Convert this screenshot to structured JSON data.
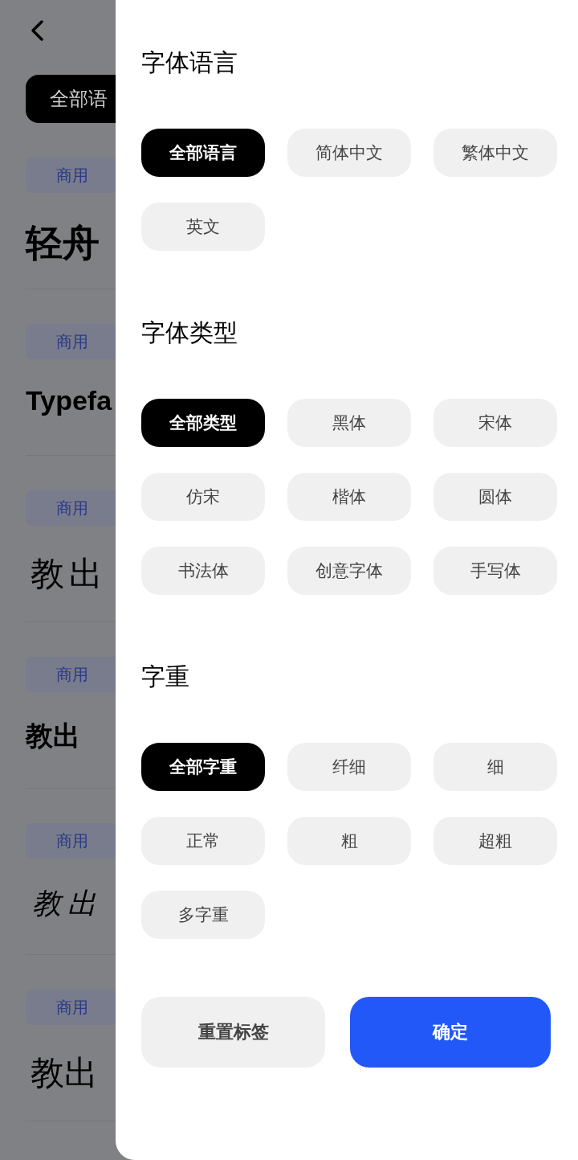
{
  "background": {
    "filter_chip": {
      "label": "全部语",
      "selected": true
    },
    "fonts": [
      {
        "tag": "商用",
        "sample": "轻舟",
        "kind": "heavy"
      },
      {
        "tag": "商用",
        "sample": "Typefa",
        "kind": "bold"
      },
      {
        "tag": "商用",
        "sample": "教出",
        "kind": "seal"
      },
      {
        "tag": "商用",
        "sample": "教出",
        "kind": "bold"
      },
      {
        "tag": "商用",
        "sample": "教出",
        "kind": "script"
      },
      {
        "tag": "商用",
        "sample": "教出",
        "kind": "serif"
      }
    ]
  },
  "drawer": {
    "sections": [
      {
        "title": "字体语言",
        "options": [
          {
            "label": "全部语言",
            "selected": true
          },
          {
            "label": "简体中文",
            "selected": false
          },
          {
            "label": "繁体中文",
            "selected": false
          },
          {
            "label": "英文",
            "selected": false
          }
        ]
      },
      {
        "title": "字体类型",
        "options": [
          {
            "label": "全部类型",
            "selected": true
          },
          {
            "label": "黑体",
            "selected": false
          },
          {
            "label": "宋体",
            "selected": false
          },
          {
            "label": "仿宋",
            "selected": false
          },
          {
            "label": "楷体",
            "selected": false
          },
          {
            "label": "圆体",
            "selected": false
          },
          {
            "label": "书法体",
            "selected": false
          },
          {
            "label": "创意字体",
            "selected": false
          },
          {
            "label": "手写体",
            "selected": false
          }
        ]
      },
      {
        "title": "字重",
        "options": [
          {
            "label": "全部字重",
            "selected": true
          },
          {
            "label": "纤细",
            "selected": false
          },
          {
            "label": "细",
            "selected": false
          },
          {
            "label": "正常",
            "selected": false
          },
          {
            "label": "粗",
            "selected": false
          },
          {
            "label": "超粗",
            "selected": false
          },
          {
            "label": "多字重",
            "selected": false
          }
        ]
      }
    ],
    "reset_button": "重置标签",
    "confirm_button": "确定"
  }
}
